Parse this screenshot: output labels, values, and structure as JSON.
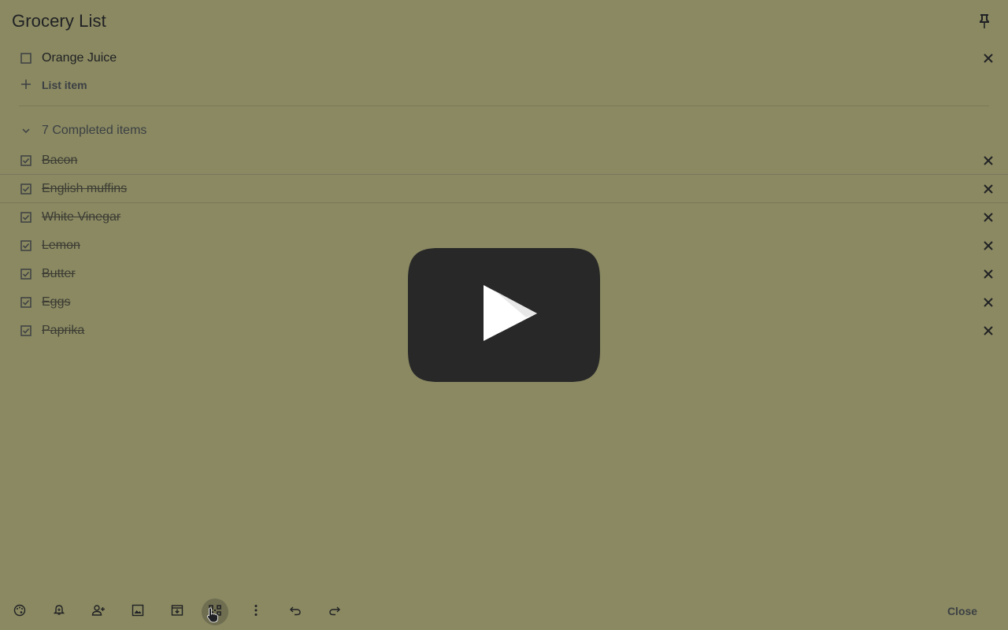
{
  "note": {
    "title": "Grocery List",
    "unchecked_items": [
      {
        "label": "Orange Juice"
      }
    ],
    "add_item_label": "List item",
    "completed_header": "7 Completed items",
    "completed_items": [
      {
        "label": "Bacon"
      },
      {
        "label": "English muffins"
      },
      {
        "label": "White Vinegar"
      },
      {
        "label": "Lemon"
      },
      {
        "label": "Butter"
      },
      {
        "label": "Eggs"
      },
      {
        "label": "Paprika"
      }
    ]
  },
  "toolbar": {
    "buttons": [
      {
        "name": "background-options",
        "icon": "palette-icon"
      },
      {
        "name": "remind-me",
        "icon": "bell-plus-icon"
      },
      {
        "name": "collaborator",
        "icon": "person-add-icon"
      },
      {
        "name": "add-image",
        "icon": "image-icon"
      },
      {
        "name": "archive",
        "icon": "archive-icon"
      },
      {
        "name": "drawing",
        "icon": "grid-icon"
      },
      {
        "name": "more",
        "icon": "more-vert-icon"
      },
      {
        "name": "undo",
        "icon": "undo-icon"
      },
      {
        "name": "redo",
        "icon": "redo-icon"
      }
    ],
    "close_label": "Close"
  },
  "colors": {
    "background": "#8a8962",
    "play_button": "#282828"
  }
}
